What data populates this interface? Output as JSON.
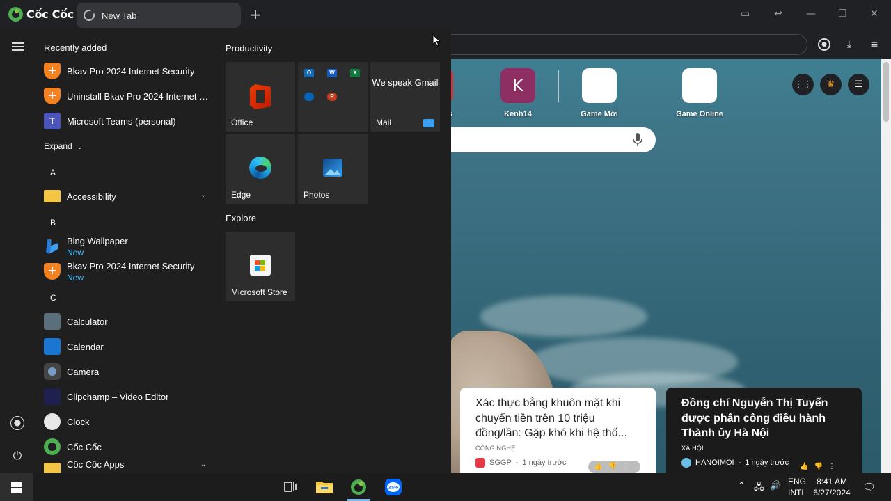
{
  "browser": {
    "brand": "Cốc Cốc",
    "tab_title": "New Tab",
    "new_tab_symbol": "+"
  },
  "speed_dial": [
    {
      "label": "s",
      "letter": ""
    },
    {
      "label": "Kenh14",
      "letter": "K"
    },
    {
      "label": "Game Mới",
      "letter": ""
    },
    {
      "label": "Game Online",
      "letter": ""
    }
  ],
  "news": [
    {
      "title": "Xác thực bằng khuôn mặt khi chuyển tiền trên 10 triệu đồng/lần: Gặp khó khi hệ thố...",
      "category": "CÔNG NGHỆ",
      "source": "SGGP",
      "time": "1 ngày trước"
    },
    {
      "title": "Đồng chí Nguyễn Thị Tuyến được phân công điều hành Thành ủy Hà Nội",
      "category": "XÃ HỘI",
      "source": "HANOIMOI",
      "time": "1 ngày trước"
    }
  ],
  "start_menu": {
    "recently_added_heading": "Recently added",
    "recent": [
      {
        "name": "Bkav Pro 2024 Internet Security"
      },
      {
        "name": "Uninstall Bkav Pro 2024 Internet Sec..."
      },
      {
        "name": "Microsoft Teams (personal)"
      }
    ],
    "expand_label": "Expand",
    "letters": {
      "a": "A",
      "b": "B",
      "c": "C"
    },
    "apps_a": [
      {
        "name": "Accessibility"
      }
    ],
    "apps_b": [
      {
        "name": "Bing Wallpaper",
        "badge": "New"
      },
      {
        "name": "Bkav Pro 2024 Internet Security",
        "badge": "New"
      }
    ],
    "apps_c": [
      {
        "name": "Calculator"
      },
      {
        "name": "Calendar"
      },
      {
        "name": "Camera"
      },
      {
        "name": "Clipchamp – Video Editor"
      },
      {
        "name": "Clock"
      },
      {
        "name": "Cốc Cốc"
      },
      {
        "name": "Cốc Cốc Apps"
      }
    ],
    "groups": {
      "productivity": "Productivity",
      "explore": "Explore"
    },
    "tiles": {
      "office": "Office",
      "mail": "Mail",
      "mail_promo": "We speak Gmail",
      "edge": "Edge",
      "photos": "Photos",
      "store": "Microsoft Store"
    }
  },
  "taskbar": {
    "language_top": "ENG",
    "language_bottom": "INTL",
    "time": "8:41 AM",
    "date": "6/27/2024"
  },
  "colors": {
    "accent_blue": "#4cc2ff",
    "kenh14": "#8e2f63",
    "start_bg": "#1f1f1f",
    "tile_bg": "#2d2d2d"
  }
}
